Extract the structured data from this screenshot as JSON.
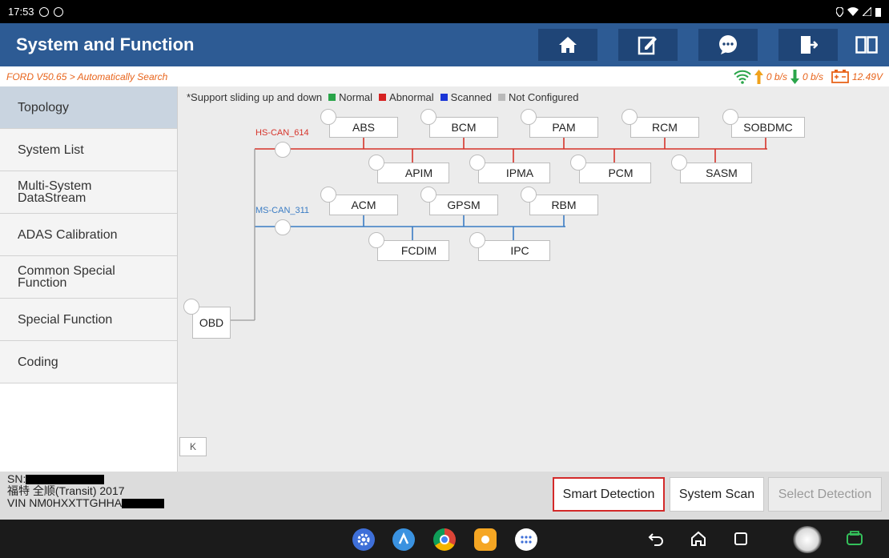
{
  "statusbar": {
    "time": "17:53"
  },
  "header": {
    "title": "System and Function"
  },
  "toolbar": {
    "home_icon": "home-icon",
    "report_icon": "edit-report-icon",
    "feedback_icon": "chat-icon",
    "exit_icon": "exit-icon",
    "split_icon": "split-view-icon"
  },
  "breadcrumb": "FORD V50.65 > Automatically Search",
  "network": {
    "up": "0 b/s",
    "down": "0 b/s",
    "voltage": "12.49V"
  },
  "sidebar": {
    "items": [
      {
        "label": "Topology",
        "active": true
      },
      {
        "label": "System List"
      },
      {
        "label": "Multi-System DataStream"
      },
      {
        "label": "ADAS Calibration"
      },
      {
        "label": "Common Special Function"
      },
      {
        "label": "Special Function"
      },
      {
        "label": "Coding"
      }
    ]
  },
  "legend": {
    "intro": "*Support sliding up and down",
    "normal": "Normal",
    "abnormal": "Abnormal",
    "scanned": "Scanned",
    "not_configured": "Not Configured",
    "colors": {
      "normal": "#2aa54a",
      "abnormal": "#d62222",
      "scanned": "#1a35d6",
      "not_configured": "#b9b9b9"
    }
  },
  "topology": {
    "obd": "OBD",
    "hs_bus": {
      "label": "HS-CAN_614",
      "color": "#d6332a",
      "top": [
        "ABS",
        "BCM",
        "PAM",
        "RCM",
        "SOBDMC"
      ],
      "bottom": [
        "APIM",
        "IPMA",
        "PCM",
        "SASM"
      ]
    },
    "ms_bus": {
      "label": "MS-CAN_311",
      "color": "#3a7cc4",
      "top": [
        "ACM",
        "GPSM",
        "RBM"
      ],
      "bottom": [
        "FCDIM",
        "IPC"
      ]
    }
  },
  "collapse_label": "K",
  "vehicle": {
    "sn_label": "SN:",
    "model": "福特 全顺(Transit) 2017",
    "vin_label": "VIN NM0HXXTTGHHA"
  },
  "actions": {
    "smart": "Smart Detection",
    "scan": "System Scan",
    "select": "Select Detection"
  }
}
